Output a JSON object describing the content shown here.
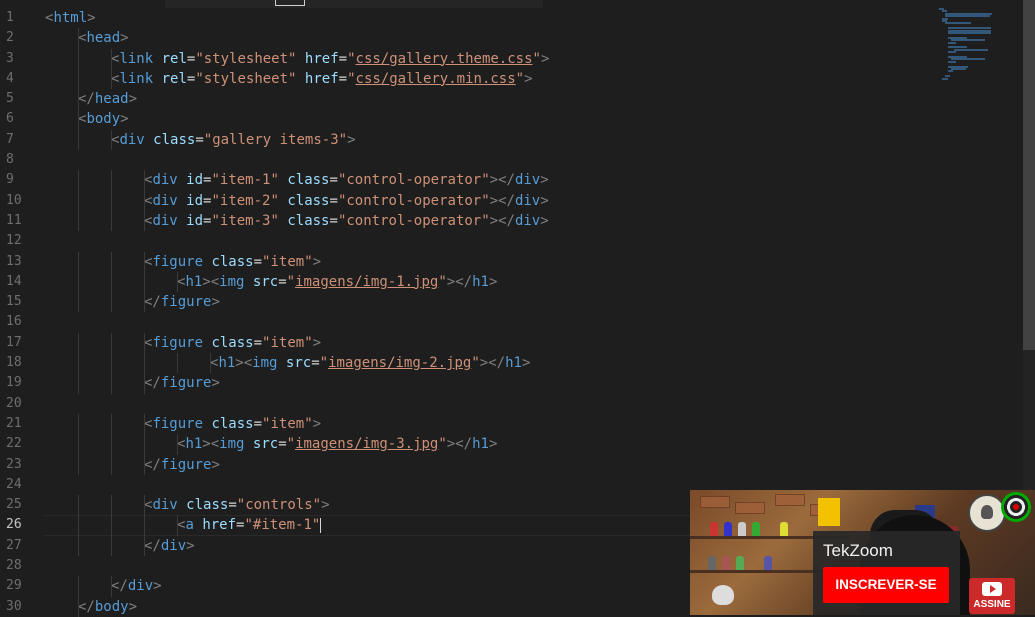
{
  "editor": {
    "line_numbers": [
      "1",
      "2",
      "3",
      "4",
      "5",
      "6",
      "7",
      "8",
      "9",
      "10",
      "11",
      "12",
      "13",
      "14",
      "15",
      "16",
      "17",
      "18",
      "19",
      "20",
      "21",
      "22",
      "23",
      "24",
      "25",
      "26",
      "27",
      "28",
      "29",
      "30"
    ],
    "active_line": "26",
    "lines": [
      {
        "indent": 0,
        "tokens": [
          [
            "p",
            "<"
          ],
          [
            "t",
            "html"
          ],
          [
            "p",
            ">"
          ]
        ]
      },
      {
        "indent": 1,
        "tokens": [
          [
            "p",
            "<"
          ],
          [
            "t",
            "head"
          ],
          [
            "p",
            ">"
          ]
        ]
      },
      {
        "indent": 2,
        "tokens": [
          [
            "p",
            "<"
          ],
          [
            "t",
            "link"
          ],
          [
            "e",
            " "
          ],
          [
            "a",
            "rel"
          ],
          [
            "e",
            "="
          ],
          [
            "s",
            "\"stylesheet\""
          ],
          [
            "e",
            " "
          ],
          [
            "a",
            "href"
          ],
          [
            "e",
            "="
          ],
          [
            "s",
            "\""
          ],
          [
            "u",
            "css/gallery.theme.css"
          ],
          [
            "s",
            "\""
          ],
          [
            "p",
            ">"
          ]
        ]
      },
      {
        "indent": 2,
        "tokens": [
          [
            "p",
            "<"
          ],
          [
            "t",
            "link"
          ],
          [
            "e",
            " "
          ],
          [
            "a",
            "rel"
          ],
          [
            "e",
            "="
          ],
          [
            "s",
            "\"stylesheet\""
          ],
          [
            "e",
            " "
          ],
          [
            "a",
            "href"
          ],
          [
            "e",
            "="
          ],
          [
            "s",
            "\""
          ],
          [
            "u",
            "css/gallery.min.css"
          ],
          [
            "s",
            "\""
          ],
          [
            "p",
            ">"
          ]
        ]
      },
      {
        "indent": 1,
        "tokens": [
          [
            "p",
            "</"
          ],
          [
            "t",
            "head"
          ],
          [
            "p",
            ">"
          ]
        ]
      },
      {
        "indent": 1,
        "tokens": [
          [
            "p",
            "<"
          ],
          [
            "t",
            "body"
          ],
          [
            "p",
            ">"
          ]
        ]
      },
      {
        "indent": 2,
        "tokens": [
          [
            "p",
            "<"
          ],
          [
            "t",
            "div"
          ],
          [
            "e",
            " "
          ],
          [
            "a",
            "class"
          ],
          [
            "e",
            "="
          ],
          [
            "s",
            "\"gallery items-3\""
          ],
          [
            "p",
            ">"
          ]
        ]
      },
      {
        "indent": 0,
        "tokens": []
      },
      {
        "indent": 3,
        "tokens": [
          [
            "p",
            "<"
          ],
          [
            "t",
            "div"
          ],
          [
            "e",
            " "
          ],
          [
            "a",
            "id"
          ],
          [
            "e",
            "="
          ],
          [
            "s",
            "\"item-1\""
          ],
          [
            "e",
            " "
          ],
          [
            "a",
            "class"
          ],
          [
            "e",
            "="
          ],
          [
            "s",
            "\"control-operator\""
          ],
          [
            "p",
            "></"
          ],
          [
            "t",
            "div"
          ],
          [
            "p",
            ">"
          ]
        ]
      },
      {
        "indent": 3,
        "tokens": [
          [
            "p",
            "<"
          ],
          [
            "t",
            "div"
          ],
          [
            "e",
            " "
          ],
          [
            "a",
            "id"
          ],
          [
            "e",
            "="
          ],
          [
            "s",
            "\"item-2\""
          ],
          [
            "e",
            " "
          ],
          [
            "a",
            "class"
          ],
          [
            "e",
            "="
          ],
          [
            "s",
            "\"control-operator\""
          ],
          [
            "p",
            "></"
          ],
          [
            "t",
            "div"
          ],
          [
            "p",
            ">"
          ]
        ]
      },
      {
        "indent": 3,
        "tokens": [
          [
            "p",
            "<"
          ],
          [
            "t",
            "div"
          ],
          [
            "e",
            " "
          ],
          [
            "a",
            "id"
          ],
          [
            "e",
            "="
          ],
          [
            "s",
            "\"item-3\""
          ],
          [
            "e",
            " "
          ],
          [
            "a",
            "class"
          ],
          [
            "e",
            "="
          ],
          [
            "s",
            "\"control-operator\""
          ],
          [
            "p",
            "></"
          ],
          [
            "t",
            "div"
          ],
          [
            "p",
            ">"
          ]
        ]
      },
      {
        "indent": 0,
        "tokens": []
      },
      {
        "indent": 3,
        "tokens": [
          [
            "p",
            "<"
          ],
          [
            "t",
            "figure"
          ],
          [
            "e",
            " "
          ],
          [
            "a",
            "class"
          ],
          [
            "e",
            "="
          ],
          [
            "s",
            "\"item\""
          ],
          [
            "p",
            ">"
          ]
        ]
      },
      {
        "indent": 4,
        "tokens": [
          [
            "p",
            "<"
          ],
          [
            "t",
            "h1"
          ],
          [
            "p",
            "><"
          ],
          [
            "t",
            "img"
          ],
          [
            "e",
            " "
          ],
          [
            "a",
            "src"
          ],
          [
            "e",
            "="
          ],
          [
            "s",
            "\""
          ],
          [
            "u",
            "imagens/img-1.jpg"
          ],
          [
            "s",
            "\""
          ],
          [
            "p",
            "></"
          ],
          [
            "t",
            "h1"
          ],
          [
            "p",
            ">"
          ]
        ]
      },
      {
        "indent": 3,
        "tokens": [
          [
            "p",
            "</"
          ],
          [
            "t",
            "figure"
          ],
          [
            "p",
            ">"
          ]
        ]
      },
      {
        "indent": 0,
        "tokens": []
      },
      {
        "indent": 3,
        "tokens": [
          [
            "p",
            "<"
          ],
          [
            "t",
            "figure"
          ],
          [
            "e",
            " "
          ],
          [
            "a",
            "class"
          ],
          [
            "e",
            "="
          ],
          [
            "s",
            "\"item\""
          ],
          [
            "p",
            ">"
          ]
        ]
      },
      {
        "indent": 5,
        "tokens": [
          [
            "p",
            "<"
          ],
          [
            "t",
            "h1"
          ],
          [
            "p",
            "><"
          ],
          [
            "t",
            "img"
          ],
          [
            "e",
            " "
          ],
          [
            "a",
            "src"
          ],
          [
            "e",
            "="
          ],
          [
            "s",
            "\""
          ],
          [
            "u",
            "imagens/img-2.jpg"
          ],
          [
            "s",
            "\""
          ],
          [
            "p",
            "></"
          ],
          [
            "t",
            "h1"
          ],
          [
            "p",
            ">"
          ]
        ]
      },
      {
        "indent": 3,
        "tokens": [
          [
            "p",
            "</"
          ],
          [
            "t",
            "figure"
          ],
          [
            "p",
            ">"
          ]
        ]
      },
      {
        "indent": 0,
        "tokens": []
      },
      {
        "indent": 3,
        "tokens": [
          [
            "p",
            "<"
          ],
          [
            "t",
            "figure"
          ],
          [
            "e",
            " "
          ],
          [
            "a",
            "class"
          ],
          [
            "e",
            "="
          ],
          [
            "s",
            "\"item\""
          ],
          [
            "p",
            ">"
          ]
        ]
      },
      {
        "indent": 4,
        "tokens": [
          [
            "p",
            "<"
          ],
          [
            "t",
            "h1"
          ],
          [
            "p",
            "><"
          ],
          [
            "t",
            "img"
          ],
          [
            "e",
            " "
          ],
          [
            "a",
            "src"
          ],
          [
            "e",
            "="
          ],
          [
            "s",
            "\""
          ],
          [
            "u",
            "imagens/img-3.jpg"
          ],
          [
            "s",
            "\""
          ],
          [
            "p",
            "></"
          ],
          [
            "t",
            "h1"
          ],
          [
            "p",
            ">"
          ]
        ]
      },
      {
        "indent": 3,
        "tokens": [
          [
            "p",
            "</"
          ],
          [
            "t",
            "figure"
          ],
          [
            "p",
            ">"
          ]
        ]
      },
      {
        "indent": 0,
        "tokens": []
      },
      {
        "indent": 3,
        "tokens": [
          [
            "p",
            "<"
          ],
          [
            "t",
            "div"
          ],
          [
            "e",
            " "
          ],
          [
            "a",
            "class"
          ],
          [
            "e",
            "="
          ],
          [
            "s",
            "\"controls\""
          ],
          [
            "p",
            ">"
          ]
        ]
      },
      {
        "indent": 4,
        "tokens": [
          [
            "p",
            "<"
          ],
          [
            "t",
            "a"
          ],
          [
            "e",
            " "
          ],
          [
            "a",
            "href"
          ],
          [
            "e",
            "="
          ],
          [
            "s",
            "\"#item-1\""
          ]
        ],
        "caret": true
      },
      {
        "indent": 3,
        "tokens": [
          [
            "p",
            "</"
          ],
          [
            "t",
            "div"
          ],
          [
            "p",
            ">"
          ]
        ]
      },
      {
        "indent": 0,
        "tokens": []
      },
      {
        "indent": 2,
        "tokens": [
          [
            "p",
            "</"
          ],
          [
            "t",
            "div"
          ],
          [
            "p",
            ">"
          ]
        ]
      },
      {
        "indent": 1,
        "tokens": [
          [
            "p",
            "</"
          ],
          [
            "t",
            "body"
          ],
          [
            "p",
            ">"
          ]
        ]
      }
    ]
  },
  "overlay": {
    "channel_name": "TekZoom",
    "subscribe_label": "INSCREVER-SE",
    "assine_label": "ASSINE"
  },
  "colors": {
    "background": "#1e1e1e",
    "tag": "#569cd6",
    "attribute": "#9cdcfe",
    "string": "#ce9178",
    "bracket": "#808080",
    "subscribe_red": "#ff0000"
  }
}
